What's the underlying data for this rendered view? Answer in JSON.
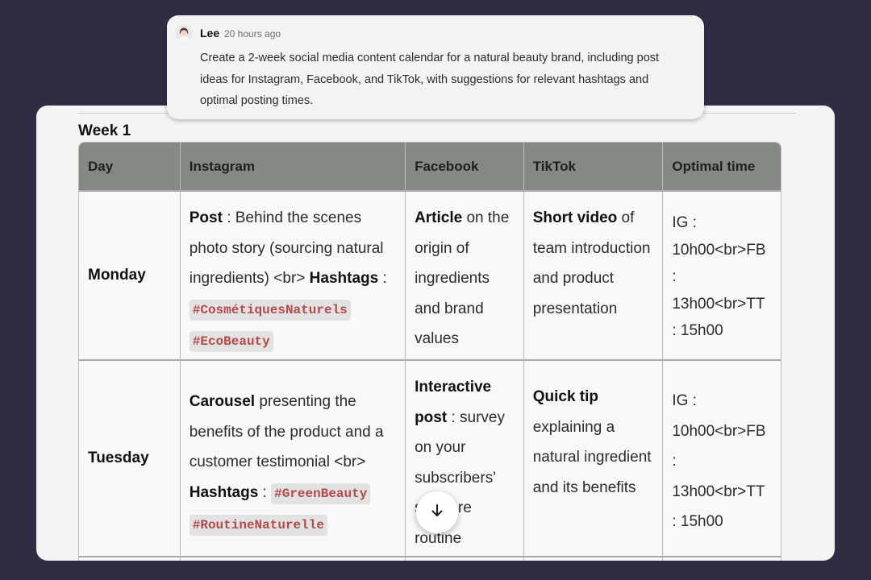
{
  "message": {
    "author": "Lee",
    "time_ago": "20 hours ago",
    "text": "Create a 2-week social media content calendar for a natural beauty brand, including post ideas for Instagram, Facebook, and TikTok, with suggestions for relevant hashtags and optimal posting times."
  },
  "calendar": {
    "week_title": "Week 1",
    "headers": [
      "Day",
      "Instagram",
      "Facebook",
      "TikTok",
      "Optimal time"
    ],
    "rows": [
      {
        "day": "Monday",
        "ig_bold": "Post",
        "ig_text": " : Behind the scenes photo story (sourcing natural ingredients) <br> ",
        "ig_hashtags_label": "Hashtags",
        "ig_sep": " : ",
        "ig_tag1": "#CosmétiquesNaturels",
        "ig_tag2": "#EcoBeauty",
        "fb_bold": "Article",
        "fb_text": " on the origin of ingredients and brand values",
        "tt_bold": "Short video",
        "tt_text": " of team introduction and product presentation",
        "time": "IG : 10h00<br>FB : 13h00<br>TT : 15h00"
      },
      {
        "day": "Tuesday",
        "ig_bold": "Carousel",
        "ig_text": " presenting the benefits of the product and a customer testimonial <br> ",
        "ig_hashtags_label": "Hashtags",
        "ig_sep": " : ",
        "ig_tag1": "#GreenBeauty",
        "ig_tag2": "#RoutineNaturelle",
        "fb_bold": "Interactive post",
        "fb_text": " : survey on your subscribers' skincare routine",
        "tt_bold": "Quick tip",
        "tt_text": " explaining a natural ingredient and its benefits",
        "time": "IG : 10h00<br>FB : 13h00<br>TT : 15h00"
      }
    ]
  },
  "ui": {
    "scroll_down_icon": "arrow-down-icon"
  }
}
